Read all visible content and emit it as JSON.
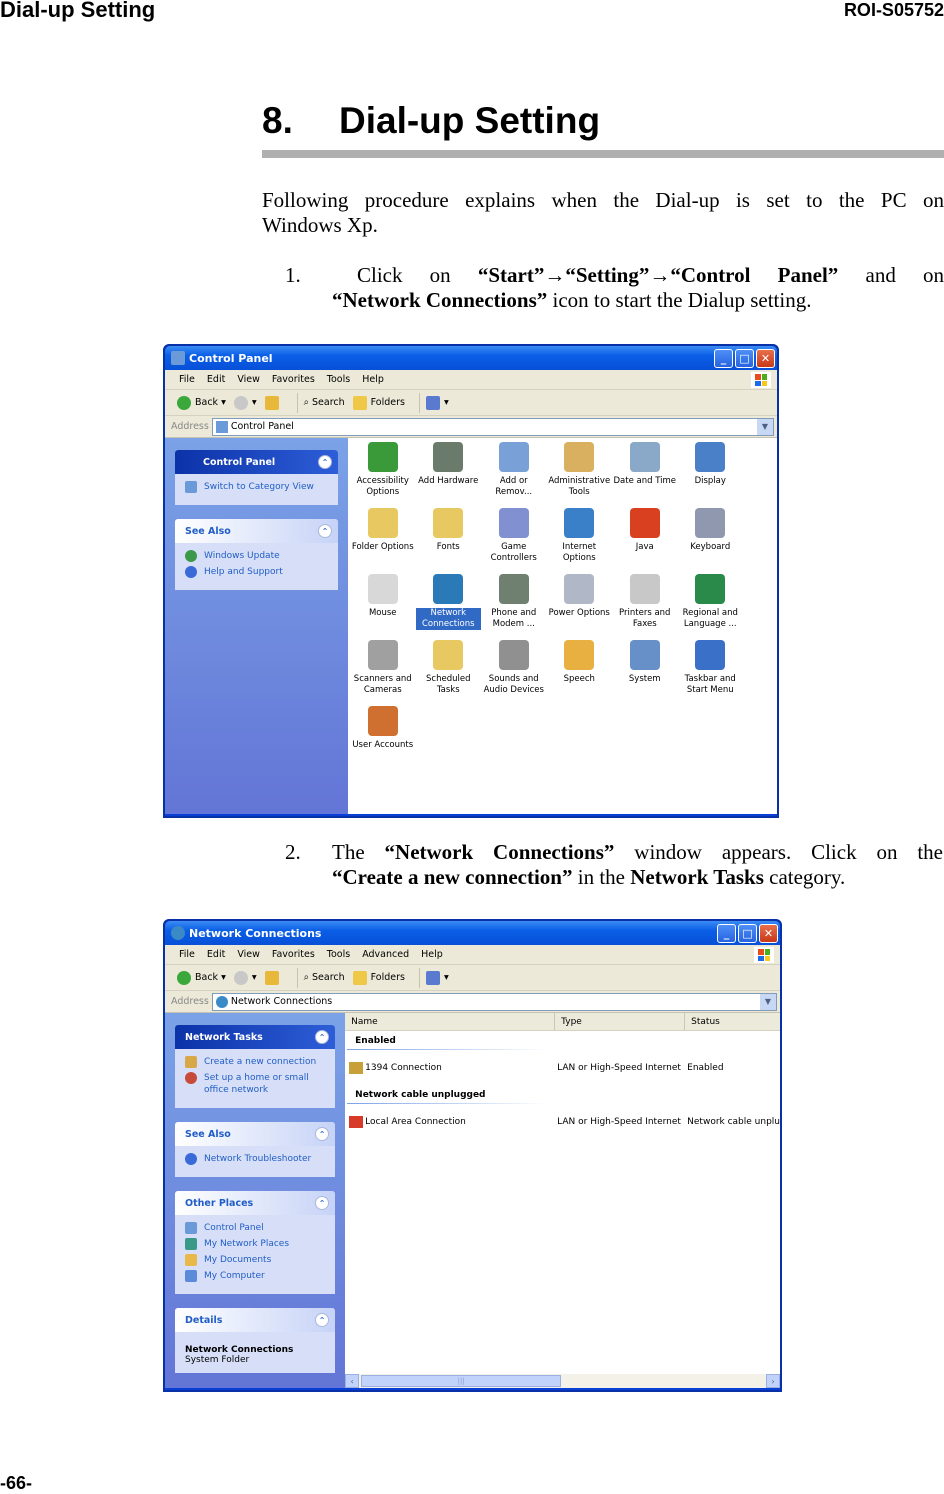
{
  "page": {
    "header_left": "Dial-up Setting",
    "header_right": "ROI-S05752",
    "footer": "-66-",
    "section_number": "8.",
    "section_title": "Dial-up Setting",
    "intro_line1": "Following procedure explains when the Dial-up is set to the PC on",
    "intro_line2": "Windows Xp.",
    "step1": {
      "number": "1.",
      "parts": [
        "Click on ",
        "“Start”→“Setting”→“Control Panel”",
        " and on",
        "“Network Connections”",
        " icon to start the Dialup setting."
      ]
    },
    "step2": {
      "number": "2.",
      "parts": [
        "The ",
        "“Network Connections”",
        " window appears. Click on the",
        "“Create a new connection”",
        " in the ",
        "Network Tasks",
        " category."
      ]
    }
  },
  "control_panel_window": {
    "title": "Control Panel",
    "menu": [
      "File",
      "Edit",
      "View",
      "Favorites",
      "Tools",
      "Help"
    ],
    "toolbar": {
      "back": "Back",
      "search": "Search",
      "folders": "Folders"
    },
    "address_label": "Address",
    "address_value": "Control Panel",
    "side_panels": [
      {
        "title": "Control Panel",
        "items": [
          "Switch to Category View"
        ]
      },
      {
        "title": "See Also",
        "items": [
          "Windows Update",
          "Help and Support"
        ]
      }
    ],
    "icons": [
      {
        "label": "Accessibility Options",
        "color": "#3a9a3a"
      },
      {
        "label": "Add Hardware",
        "color": "#6b7b6b"
      },
      {
        "label": "Add or Remov...",
        "color": "#7aa0d8"
      },
      {
        "label": "Administrative Tools",
        "color": "#d8b060"
      },
      {
        "label": "Date and Time",
        "color": "#8aa8c8"
      },
      {
        "label": "Display",
        "color": "#4a80c8"
      },
      {
        "label": "Folder Options",
        "color": "#e8c860"
      },
      {
        "label": "Fonts",
        "color": "#e8c860"
      },
      {
        "label": "Game Controllers",
        "color": "#8090d0"
      },
      {
        "label": "Internet Options",
        "color": "#3a80c8"
      },
      {
        "label": "Java",
        "color": "#d84020"
      },
      {
        "label": "Keyboard",
        "color": "#9098b0"
      },
      {
        "label": "Mouse",
        "color": "#d8d8d8"
      },
      {
        "label": "Network Connections",
        "color": "#2a7ab8",
        "selected": true
      },
      {
        "label": "Phone and Modem ...",
        "color": "#708070"
      },
      {
        "label": "Power Options",
        "color": "#b0b8c8"
      },
      {
        "label": "Printers and Faxes",
        "color": "#c8c8c8"
      },
      {
        "label": "Regional and Language ...",
        "color": "#2a8a4a"
      },
      {
        "label": "Scanners and Cameras",
        "color": "#a0a0a0"
      },
      {
        "label": "Scheduled Tasks",
        "color": "#e8c860"
      },
      {
        "label": "Sounds and Audio Devices",
        "color": "#909090"
      },
      {
        "label": "Speech",
        "color": "#e8b040"
      },
      {
        "label": "System",
        "color": "#6890c8"
      },
      {
        "label": "Taskbar and Start Menu",
        "color": "#3a70c8"
      },
      {
        "label": "User Accounts",
        "color": "#d07030"
      }
    ]
  },
  "network_window": {
    "title": "Network Connections",
    "menu": [
      "File",
      "Edit",
      "View",
      "Favorites",
      "Tools",
      "Advanced",
      "Help"
    ],
    "toolbar": {
      "back": "Back",
      "search": "Search",
      "folders": "Folders"
    },
    "address_label": "Address",
    "address_value": "Network Connections",
    "side_panels": [
      {
        "title": "Network Tasks",
        "items": [
          "Create a new connection",
          "Set up a home or small office network"
        ]
      },
      {
        "title": "See Also",
        "items": [
          "Network Troubleshooter"
        ]
      },
      {
        "title": "Other Places",
        "items": [
          "Control Panel",
          "My Network Places",
          "My Documents",
          "My Computer"
        ]
      },
      {
        "title": "Details",
        "detail_name": "Network Connections",
        "detail_type": "System Folder"
      }
    ],
    "columns": [
      "Name",
      "Type",
      "Status"
    ],
    "groups": [
      {
        "name": "Enabled",
        "rows": [
          {
            "name": "1394 Connection",
            "type": "LAN or High-Speed Internet",
            "status": "Enabled"
          }
        ]
      },
      {
        "name": "Network cable unplugged",
        "rows": [
          {
            "name": "Local Area Connection",
            "type": "LAN or High-Speed Internet",
            "status": "Network cable unplu"
          }
        ]
      }
    ]
  }
}
